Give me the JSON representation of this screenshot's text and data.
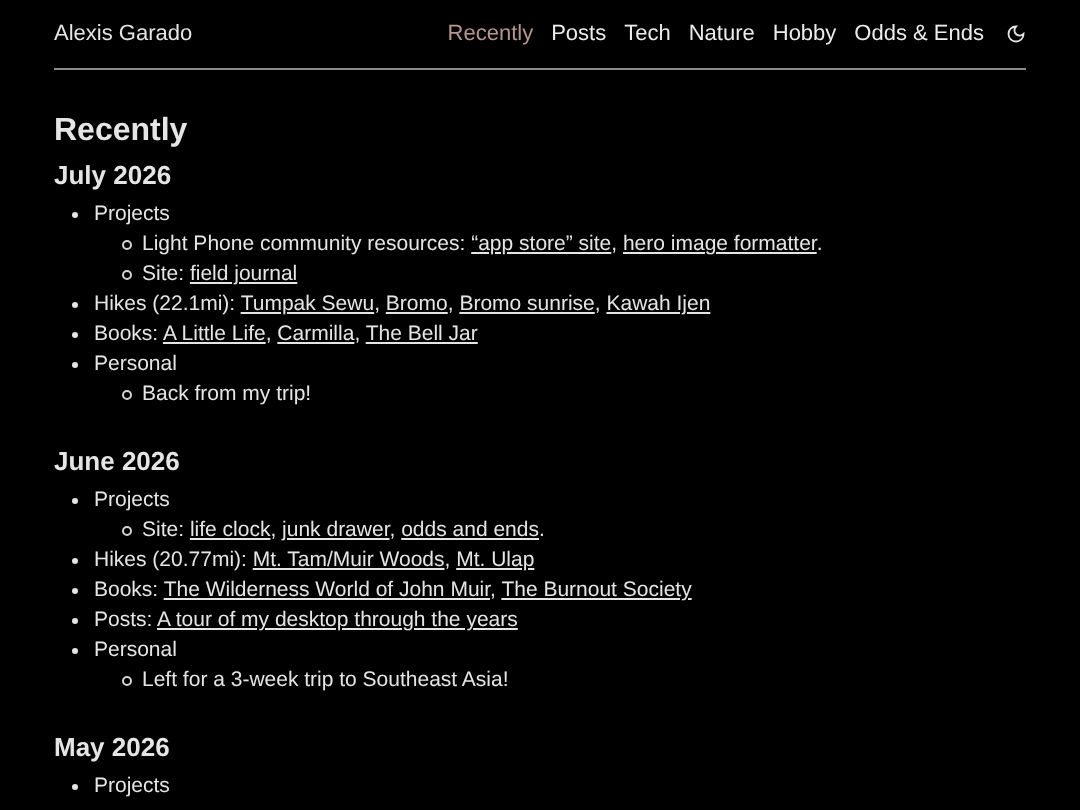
{
  "header": {
    "site_title": "Alexis Garado",
    "nav": [
      {
        "label": "Recently",
        "selected": true
      },
      {
        "label": "Posts",
        "selected": false
      },
      {
        "label": "Tech",
        "selected": false
      },
      {
        "label": "Nature",
        "selected": false
      },
      {
        "label": "Hobby",
        "selected": false
      },
      {
        "label": "Odds & Ends",
        "selected": false
      }
    ]
  },
  "page_title": "Recently",
  "months": [
    {
      "title": "July 2026",
      "items": [
        {
          "label": "Projects",
          "children": [
            {
              "label": "Light Phone community resources: ",
              "links": [
                {
                  "text": "“app store” site",
                  "after": ", "
                },
                {
                  "text": "hero image formatter",
                  "after": "."
                }
              ]
            },
            {
              "label": "Site: ",
              "links": [
                {
                  "text": "field journal"
                }
              ]
            }
          ]
        },
        {
          "label": "Hikes (22.1mi): ",
          "links": [
            {
              "text": "Tumpak Sewu",
              "after": ", "
            },
            {
              "text": "Bromo",
              "after": ", "
            },
            {
              "text": "Bromo sunrise",
              "after": ", "
            },
            {
              "text": "Kawah Ijen"
            }
          ]
        },
        {
          "label": "Books: ",
          "links": [
            {
              "text": "A Little Life",
              "after": ", "
            },
            {
              "text": "Carmilla",
              "after": ", "
            },
            {
              "text": "The Bell Jar"
            }
          ]
        },
        {
          "label": "Personal",
          "children": [
            {
              "label": "Back from my trip!"
            }
          ]
        }
      ]
    },
    {
      "title": "June 2026",
      "items": [
        {
          "label": "Projects",
          "children": [
            {
              "label": "Site: ",
              "links": [
                {
                  "text": "life clock",
                  "after": ", "
                },
                {
                  "text": "junk drawer",
                  "after": ", "
                },
                {
                  "text": "odds and ends",
                  "after": "."
                }
              ]
            }
          ]
        },
        {
          "label": "Hikes (20.77mi): ",
          "links": [
            {
              "text": "Mt. Tam/Muir Woods",
              "after": ", "
            },
            {
              "text": "Mt. Ulap"
            }
          ]
        },
        {
          "label": "Books: ",
          "links": [
            {
              "text": "The Wilderness World of John Muir",
              "after": ", "
            },
            {
              "text": "The Burnout Society"
            }
          ]
        },
        {
          "label": "Posts: ",
          "links": [
            {
              "text": "A tour of my desktop through the years"
            }
          ]
        },
        {
          "label": "Personal",
          "children": [
            {
              "label": "Left for a 3-week trip to Southeast Asia!"
            }
          ]
        }
      ]
    },
    {
      "title": "May 2026",
      "items": [
        {
          "label": "Projects"
        }
      ]
    }
  ]
}
